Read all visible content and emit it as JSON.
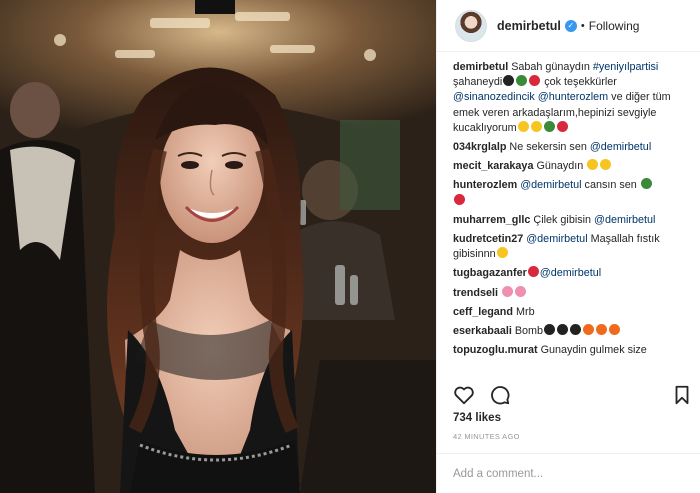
{
  "header": {
    "username": "demirbetul",
    "separator": "•",
    "follow_status": "Following"
  },
  "caption": {
    "user": "demirbetul",
    "text_1": "Sabah günaydın ",
    "hashtag": "#yeniyılpartisi",
    "text_2": " şahaneydi",
    "text_3": " çok teşekkürler ",
    "mention_1": "@sinanozedincik",
    "mention_2": "@hunterozlem",
    "text_4": " ve diğer tüm emek veren arkadaşlarım,hepinizi sevgiyle kucaklıyorum"
  },
  "comments": [
    {
      "user": "034krglalp",
      "text": "Ne sekersin sen ",
      "mention": "@demirbetul",
      "emoji": []
    },
    {
      "user": "mecit_karakaya",
      "text": "Günaydın ",
      "mention": "",
      "emoji": [
        "yellow",
        "yellow"
      ]
    },
    {
      "user": "hunterozlem",
      "text": "",
      "mention": "@demirbetul",
      "text_after": " cansın sen ",
      "emoji": [
        "green",
        "red"
      ]
    },
    {
      "user": "muharrem_gllc",
      "text": "Çilek gibisin ",
      "mention": "@demirbetul",
      "emoji": []
    },
    {
      "user": "kudretcetin27",
      "text": "",
      "mention": "@demirbetul",
      "text_after": " Maşallah fıstık gibisinnn",
      "emoji": [
        "yellow"
      ]
    },
    {
      "user": "tugbagazanfer",
      "text": "",
      "mention": "@demirbetul",
      "emoji_before": [
        "red"
      ],
      "emoji": []
    },
    {
      "user": "trendseli",
      "text": "",
      "mention": "",
      "emoji": [
        "pink",
        "pink"
      ]
    },
    {
      "user": "ceff_legand",
      "text": "Mrb",
      "mention": "",
      "emoji": []
    },
    {
      "user": "eserkabaali",
      "text": "Bomb",
      "mention": "",
      "emoji": [
        "black",
        "black",
        "black",
        "orange",
        "orange",
        "orange"
      ]
    },
    {
      "user": "topuzoglu.murat",
      "text": "Gunaydin gulmek size",
      "mention": "",
      "emoji": []
    }
  ],
  "likes": "734 likes",
  "timestamp": "42 MINUTES AGO",
  "add_comment_placeholder": "Add a comment...",
  "colors": {
    "link": "#003569",
    "verified": "#3897f0",
    "muted": "#999999",
    "text": "#262626"
  },
  "icons": {
    "heart": "heart-icon",
    "comment": "comment-icon",
    "bookmark": "bookmark-icon",
    "verified": "verified-badge-icon"
  }
}
